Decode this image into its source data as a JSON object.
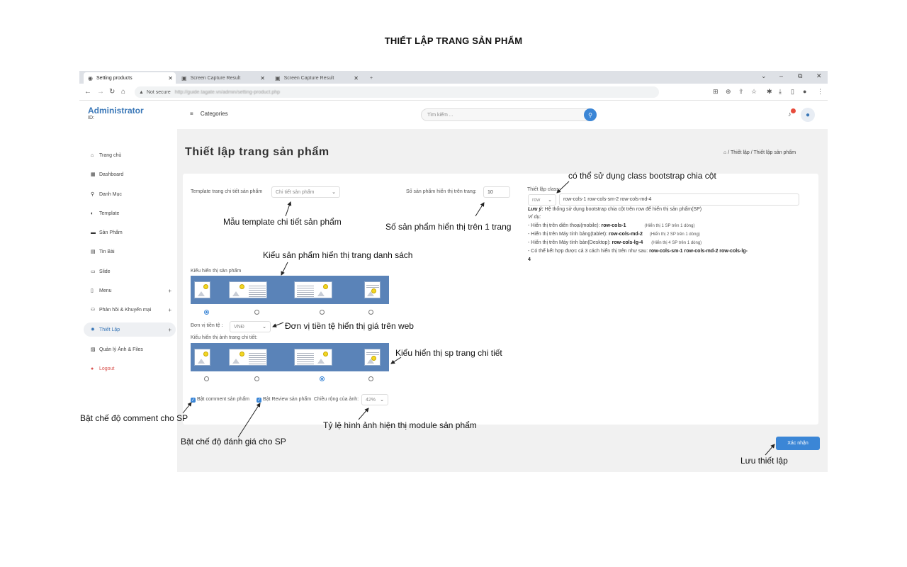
{
  "page_heading": "THIẾT LẬP  TRANG SẢN PHẨM",
  "browser": {
    "tabs": [
      {
        "label": "Setting products",
        "active": true
      },
      {
        "label": "Screen Capture Result",
        "active": false
      },
      {
        "label": "Screen Capture Result",
        "active": false
      }
    ],
    "new_tab": "+",
    "security": "Not secure",
    "url": "http://guide.tagate.vn/admin/setting-product.php"
  },
  "sidebar": {
    "brand": "Administrator",
    "id_label": "ID:",
    "items": [
      {
        "label": "Trang chủ",
        "icon": "home-icon"
      },
      {
        "label": "Dashboard",
        "icon": "dashboard-icon"
      },
      {
        "label": "Danh Mục",
        "icon": "link-icon"
      },
      {
        "label": "Template",
        "icon": "template-icon"
      },
      {
        "label": "Sản Phẩm",
        "icon": "product-icon"
      },
      {
        "label": "Tin Bài",
        "icon": "news-icon"
      },
      {
        "label": "Slide",
        "icon": "slide-icon"
      },
      {
        "label": "Menu",
        "icon": "menu-icon",
        "expand": "+"
      },
      {
        "label": "Phản hồi & Khuyến mại",
        "icon": "user-icon",
        "expand": "+"
      },
      {
        "label": "Thiết Lập",
        "icon": "settings-icon",
        "expand": "+",
        "active": true
      },
      {
        "label": "Quản lý Ảnh & Files",
        "icon": "files-icon"
      },
      {
        "label": "Logout",
        "icon": "logout-icon"
      }
    ]
  },
  "topbar": {
    "categories": "Categories",
    "search_placeholder": "Tìm kiếm ..."
  },
  "main": {
    "title": "Thiết lập trang sản phẩm",
    "breadcrumb": [
      "⌂",
      "Thiết lập",
      "Thiết lập sản phẩm"
    ],
    "template_label": "Template trang chi tiết sản phẩm",
    "template_value": "Chi tiết sản phẩm",
    "per_page_label": "Số sản phẩm hiển thị trên trang:",
    "per_page_value": "10",
    "class_label": "Thiết lập class:",
    "class_select": "row",
    "class_value": "row-cols-1 row-cols-sm-2 row-cols-md-4",
    "note_title": "Lưu ý:",
    "note_text": "Hệ thống sử dụng bootstrap chia cột trên row để hiển thị sản phẩm(SP)",
    "note_example": "Ví dụ:",
    "note_lines": [
      {
        "text": "- Hiển thị trên diên thoại(mobile): ",
        "code": "row-cols-1",
        "hint": "(Hiển thị 1 SP trên 1 dòng)"
      },
      {
        "text": "- Hiển thị trên Máy tính bảng(tablet): ",
        "code": "row-cols-md-2",
        "hint": "(Hiển thị 2 SP trên 1 dòng)"
      },
      {
        "text": "- Hiển thị trên Máy tính bàn(Desktop): ",
        "code": "row-cols-lg-4",
        "hint": "(Hiển thị 4 SP trên 1 dòng)"
      }
    ],
    "note_combo_text": "- Có thể kết hợp được cả 3 cách hiển thị trên như sau: ",
    "note_combo_code": "row-cols-sm-1 row-cols-md-2 row-cols-lg-",
    "note_combo_tail": "4",
    "list_layout_label": "Kiểu hiển thị sản phẩm",
    "list_layout_selected": 1,
    "currency_label": "Đơn vị tiền tệ :",
    "currency_value": "VNĐ",
    "detail_layout_label": "Kiểu hiển thị ảnh trang chi tiết:",
    "detail_layout_selected": 3,
    "comment_label": "Bật comment sản phẩm",
    "review_label": "Bật Review sản phẩm",
    "image_width_label": "Chiều rộng của ảnh:",
    "image_width_value": "42%",
    "submit_label": "Xác nhận"
  },
  "annotations": {
    "bootstrap": "có thể sử dụng class bootstrap chia cột",
    "template": "Mẫu template chi tiết sản phẩm",
    "per_page": "Số sản phẩm hiển thị trên 1 trang",
    "list_layout": "Kiểu sản phẩm hiển thị trang danh sách",
    "currency": "Đơn vị tiền tệ hiển thị  giá trên web",
    "detail_layout": "Kiểu hiển thị  sp trang chi tiết",
    "comment": "Bật chế độ comment cho SP",
    "review": "Bật chế độ đánh giá cho SP",
    "ratio": "Tỷ lệ hình ảnh hiện thị module sản phẩm",
    "save": "Lưu thiết lập"
  },
  "colors": {
    "accent": "#3b86d6",
    "brand": "#3b78b8",
    "strip": "#5a83b8",
    "logout": "#d9534f"
  }
}
